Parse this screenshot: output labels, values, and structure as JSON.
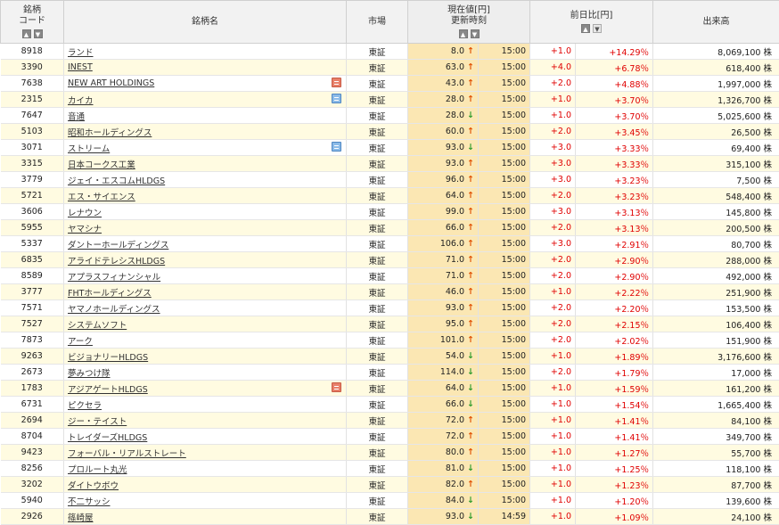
{
  "header": {
    "code_line1": "銘柄",
    "code_line2": "コード",
    "name": "銘柄名",
    "market": "市場",
    "price_line1": "現在値[円]",
    "price_line2": "更新時刻",
    "change": "前日比[円]",
    "volume": "出来高"
  },
  "sort": {
    "up": "▲",
    "down": "▼"
  },
  "colors": {
    "positive": "#e00000",
    "up_arrow": "#e05000",
    "down_arrow": "#2a9a2a",
    "price_bg": "#fbe7b3",
    "stripe": "#fffbe1"
  },
  "rows": [
    {
      "code": "8918",
      "name": "ランド",
      "market": "東証",
      "price": "8.0",
      "dir": "up",
      "time": "15:00",
      "change": "+1.0",
      "pct": "+14.29％",
      "volume": "8,069,100 株",
      "icon": ""
    },
    {
      "code": "3390",
      "name": "INEST",
      "market": "東証",
      "price": "63.0",
      "dir": "up",
      "time": "15:00",
      "change": "+4.0",
      "pct": "+6.78％",
      "volume": "618,400 株",
      "icon": ""
    },
    {
      "code": "7638",
      "name": "NEW ART HOLDINGS",
      "market": "東証",
      "price": "43.0",
      "dir": "up",
      "time": "15:00",
      "change": "+2.0",
      "pct": "+4.88％",
      "volume": "1,997,000 株",
      "icon": "red"
    },
    {
      "code": "2315",
      "name": "カイカ",
      "market": "東証",
      "price": "28.0",
      "dir": "up",
      "time": "15:00",
      "change": "+1.0",
      "pct": "+3.70％",
      "volume": "1,326,700 株",
      "icon": "blue"
    },
    {
      "code": "7647",
      "name": "音通",
      "market": "東証",
      "price": "28.0",
      "dir": "down",
      "time": "15:00",
      "change": "+1.0",
      "pct": "+3.70％",
      "volume": "5,025,600 株",
      "icon": ""
    },
    {
      "code": "5103",
      "name": "昭和ホールディングス",
      "market": "東証",
      "price": "60.0",
      "dir": "up",
      "time": "15:00",
      "change": "+2.0",
      "pct": "+3.45％",
      "volume": "26,500 株",
      "icon": ""
    },
    {
      "code": "3071",
      "name": "ストリーム",
      "market": "東証",
      "price": "93.0",
      "dir": "down",
      "time": "15:00",
      "change": "+3.0",
      "pct": "+3.33％",
      "volume": "69,400 株",
      "icon": "blue"
    },
    {
      "code": "3315",
      "name": "日本コークス工業",
      "market": "東証",
      "price": "93.0",
      "dir": "up",
      "time": "15:00",
      "change": "+3.0",
      "pct": "+3.33％",
      "volume": "315,100 株",
      "icon": ""
    },
    {
      "code": "3779",
      "name": "ジェイ・エスコムHLDGS",
      "market": "東証",
      "price": "96.0",
      "dir": "up",
      "time": "15:00",
      "change": "+3.0",
      "pct": "+3.23％",
      "volume": "7,500 株",
      "icon": ""
    },
    {
      "code": "5721",
      "name": "エス・サイエンス",
      "market": "東証",
      "price": "64.0",
      "dir": "up",
      "time": "15:00",
      "change": "+2.0",
      "pct": "+3.23％",
      "volume": "548,400 株",
      "icon": ""
    },
    {
      "code": "3606",
      "name": "レナウン",
      "market": "東証",
      "price": "99.0",
      "dir": "up",
      "time": "15:00",
      "change": "+3.0",
      "pct": "+3.13％",
      "volume": "145,800 株",
      "icon": ""
    },
    {
      "code": "5955",
      "name": "ヤマシナ",
      "market": "東証",
      "price": "66.0",
      "dir": "up",
      "time": "15:00",
      "change": "+2.0",
      "pct": "+3.13％",
      "volume": "200,500 株",
      "icon": ""
    },
    {
      "code": "5337",
      "name": "ダントーホールディングス",
      "market": "東証",
      "price": "106.0",
      "dir": "up",
      "time": "15:00",
      "change": "+3.0",
      "pct": "+2.91％",
      "volume": "80,700 株",
      "icon": ""
    },
    {
      "code": "6835",
      "name": "アライドテレシスHLDGS",
      "market": "東証",
      "price": "71.0",
      "dir": "up",
      "time": "15:00",
      "change": "+2.0",
      "pct": "+2.90％",
      "volume": "288,000 株",
      "icon": ""
    },
    {
      "code": "8589",
      "name": "アプラスフィナンシャル",
      "market": "東証",
      "price": "71.0",
      "dir": "up",
      "time": "15:00",
      "change": "+2.0",
      "pct": "+2.90％",
      "volume": "492,000 株",
      "icon": ""
    },
    {
      "code": "3777",
      "name": "FHTホールディングス",
      "market": "東証",
      "price": "46.0",
      "dir": "up",
      "time": "15:00",
      "change": "+1.0",
      "pct": "+2.22％",
      "volume": "251,900 株",
      "icon": ""
    },
    {
      "code": "7571",
      "name": "ヤマノホールディングス",
      "market": "東証",
      "price": "93.0",
      "dir": "up",
      "time": "15:00",
      "change": "+2.0",
      "pct": "+2.20％",
      "volume": "153,500 株",
      "icon": ""
    },
    {
      "code": "7527",
      "name": "システムソフト",
      "market": "東証",
      "price": "95.0",
      "dir": "up",
      "time": "15:00",
      "change": "+2.0",
      "pct": "+2.15％",
      "volume": "106,400 株",
      "icon": ""
    },
    {
      "code": "7873",
      "name": "アーク",
      "market": "東証",
      "price": "101.0",
      "dir": "up",
      "time": "15:00",
      "change": "+2.0",
      "pct": "+2.02％",
      "volume": "151,900 株",
      "icon": ""
    },
    {
      "code": "9263",
      "name": "ビジョナリーHLDGS",
      "market": "東証",
      "price": "54.0",
      "dir": "down",
      "time": "15:00",
      "change": "+1.0",
      "pct": "+1.89％",
      "volume": "3,176,600 株",
      "icon": ""
    },
    {
      "code": "2673",
      "name": "夢みつけ隊",
      "market": "東証",
      "price": "114.0",
      "dir": "down",
      "time": "15:00",
      "change": "+2.0",
      "pct": "+1.79％",
      "volume": "17,000 株",
      "icon": ""
    },
    {
      "code": "1783",
      "name": "アジアゲートHLDGS",
      "market": "東証",
      "price": "64.0",
      "dir": "down",
      "time": "15:00",
      "change": "+1.0",
      "pct": "+1.59％",
      "volume": "161,200 株",
      "icon": "red"
    },
    {
      "code": "6731",
      "name": "ピクセラ",
      "market": "東証",
      "price": "66.0",
      "dir": "down",
      "time": "15:00",
      "change": "+1.0",
      "pct": "+1.54％",
      "volume": "1,665,400 株",
      "icon": ""
    },
    {
      "code": "2694",
      "name": "ジー・テイスト",
      "market": "東証",
      "price": "72.0",
      "dir": "up",
      "time": "15:00",
      "change": "+1.0",
      "pct": "+1.41％",
      "volume": "84,100 株",
      "icon": ""
    },
    {
      "code": "8704",
      "name": "トレイダーズHLDGS",
      "market": "東証",
      "price": "72.0",
      "dir": "up",
      "time": "15:00",
      "change": "+1.0",
      "pct": "+1.41％",
      "volume": "349,700 株",
      "icon": ""
    },
    {
      "code": "9423",
      "name": "フォーバル・リアルストレート",
      "market": "東証",
      "price": "80.0",
      "dir": "up",
      "time": "15:00",
      "change": "+1.0",
      "pct": "+1.27％",
      "volume": "55,700 株",
      "icon": ""
    },
    {
      "code": "8256",
      "name": "プロルート丸光",
      "market": "東証",
      "price": "81.0",
      "dir": "down",
      "time": "15:00",
      "change": "+1.0",
      "pct": "+1.25％",
      "volume": "118,100 株",
      "icon": ""
    },
    {
      "code": "3202",
      "name": "ダイトウボウ",
      "market": "東証",
      "price": "82.0",
      "dir": "up",
      "time": "15:00",
      "change": "+1.0",
      "pct": "+1.23％",
      "volume": "87,700 株",
      "icon": ""
    },
    {
      "code": "5940",
      "name": "不二サッシ",
      "market": "東証",
      "price": "84.0",
      "dir": "down",
      "time": "15:00",
      "change": "+1.0",
      "pct": "+1.20％",
      "volume": "139,600 株",
      "icon": ""
    },
    {
      "code": "2926",
      "name": "篠崎屋",
      "market": "東証",
      "price": "93.0",
      "dir": "down",
      "time": "14:59",
      "change": "+1.0",
      "pct": "+1.09％",
      "volume": "24,100 株",
      "icon": ""
    }
  ]
}
